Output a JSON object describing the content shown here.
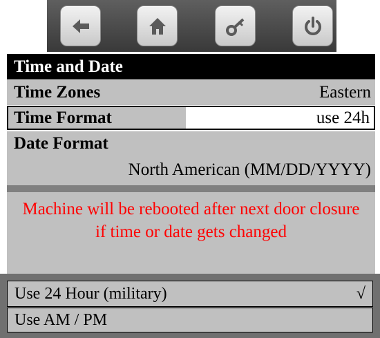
{
  "toolbar": {
    "buttons": [
      {
        "name": "back",
        "icon": "back-arrow-icon"
      },
      {
        "name": "home",
        "icon": "home-icon"
      },
      {
        "name": "key",
        "icon": "key-icon"
      },
      {
        "name": "power",
        "icon": "power-icon"
      }
    ]
  },
  "section_title": "Time and Date",
  "settings": {
    "time_zones": {
      "label": "Time Zones",
      "value": "Eastern"
    },
    "time_format": {
      "label": "Time Format",
      "value": "use 24h"
    },
    "date_format": {
      "label": "Date Format",
      "value": "North American (MM/DD/YYYY)"
    }
  },
  "warning": {
    "text": "Machine will be rebooted after next door closure if time or date gets changed",
    "color": "#ff0000"
  },
  "options": [
    {
      "label": "Use 24 Hour (military)",
      "selected": true,
      "check": "√"
    },
    {
      "label": "Use AM / PM",
      "selected": false,
      "check": ""
    }
  ]
}
